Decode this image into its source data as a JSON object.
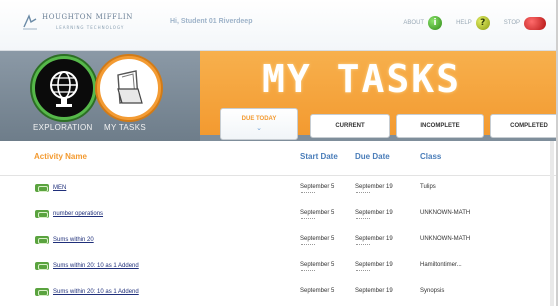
{
  "topbar": {
    "logo_text": "HOUGHTON MIFFLIN",
    "logo_subtext": "LEARNING TECHNOLOGY",
    "greeting": "Hi, Student 01 Riverdeep",
    "links": {
      "about": "ABOUT",
      "about_icon": "i",
      "help": "HELP",
      "help_icon": "?",
      "stop": "STOP"
    }
  },
  "header": {
    "title": "MY TASKS",
    "exploration_label": "EXPLORATION",
    "mytasks_label": "MY TASKS"
  },
  "tabs": {
    "due_today": "DUE TODAY",
    "current": "CURRENT",
    "incomplete": "INCOMPLETE",
    "completed": "COMPLETED"
  },
  "table": {
    "headers": {
      "activity": "Activity Name",
      "start": "Start Date",
      "due": "Due Date",
      "class": "Class"
    },
    "rows": [
      {
        "activity": "MEN",
        "start": "September 5",
        "due": "September 19",
        "class": "Tulips"
      },
      {
        "activity": "number operations",
        "start": "September 5",
        "due": "September 19",
        "class": "UNKNOWN-MATH"
      },
      {
        "activity": "Sums within 20",
        "start": "September 5",
        "due": "September 19",
        "class": "UNKNOWN-MATH"
      },
      {
        "activity": "Sums within 20: 10 as 1 Addend",
        "start": "September 5",
        "due": "September 19",
        "class": "Hamiltontimer..."
      },
      {
        "activity": "Sums within 20: 10 as 1 Addend",
        "start": "September 5",
        "due": "September 19",
        "class": "Synopsis"
      }
    ]
  },
  "colors": {
    "accent_orange": "#F39A30",
    "header_blue": "#4A7DB9",
    "badge_green": "#5AA33F"
  }
}
